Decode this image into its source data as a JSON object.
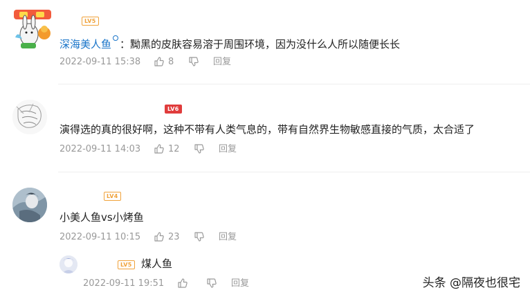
{
  "comments": [
    {
      "nickname": "深海美人鱼",
      "level": "LV5",
      "sep": "：",
      "text": "黝黑的皮肤容易溶于周围环境，因为没什么人所以随便长长",
      "time": "2022-09-11 15:38",
      "likes": "8",
      "reply": "回复"
    },
    {
      "level": "LV6",
      "text": "演得选的真的很好啊，这种不带有人类气息的，带有自然界生物敏感直接的气质，太合适了",
      "time": "2022-09-11 14:03",
      "likes": "12",
      "reply": "回复"
    },
    {
      "level": "LV4",
      "text": "小美人鱼vs小烤鱼",
      "time": "2022-09-11 10:15",
      "likes": "23",
      "reply": "回复"
    }
  ],
  "reply": {
    "level": "LV5",
    "text": "煤人鱼",
    "time": "2022-09-11 19:51",
    "reply": "回复"
  },
  "watermark": "头条 @隔夜也很宅",
  "colors": {
    "nickname": "#1a75c9",
    "level_orange": "#f0a23a",
    "level_red": "#e03c3c",
    "meta": "#999999"
  }
}
